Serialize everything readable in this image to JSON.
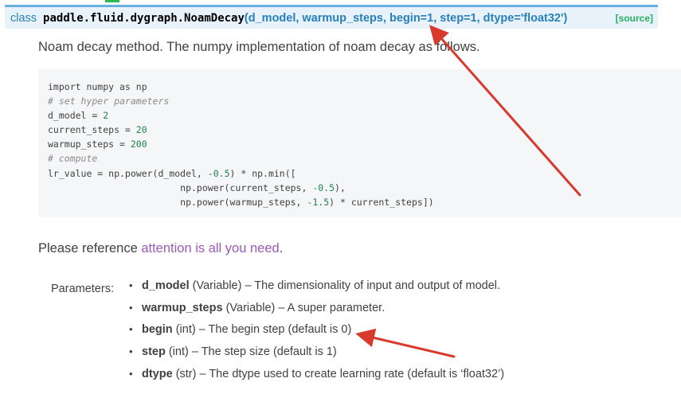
{
  "signature": {
    "keyword": "class",
    "name": "paddle.fluid.dygraph.NoamDecay",
    "params": "(d_model, warmup_steps, begin=1, step=1, dtype='float32')",
    "source_link": "[source]"
  },
  "description": "Noam decay method. The numpy implementation of noam decay as follows.",
  "code": {
    "lines": [
      "import numpy as np",
      "# set hyper parameters",
      "d_model = 2",
      "current_steps = 20",
      "warmup_steps = 200",
      "# compute",
      "lr_value = np.power(d_model, -0.5) * np.min([",
      "                        np.power(current_steps, -0.5),",
      "                        np.power(warmup_steps, -1.5) * current_steps])"
    ]
  },
  "reference": {
    "prefix": "Please reference ",
    "link": "attention is all you need",
    "suffix": "."
  },
  "parameters": {
    "label": "Parameters:",
    "items": [
      {
        "name": "d_model",
        "desc": " (Variable) – The dimensionality of input and output of model."
      },
      {
        "name": "warmup_steps",
        "desc": " (Variable) – A super parameter."
      },
      {
        "name": "begin",
        "desc": " (int) – The begin step (default is 0)"
      },
      {
        "name": "step",
        "desc": " (int) – The step size (default is 1)"
      },
      {
        "name": "dtype",
        "desc": " (str) – The dtype used to create learning rate (default is ‘float32’)"
      }
    ]
  },
  "colors": {
    "link": "#2980b9",
    "visited_link": "#9b59b6",
    "signature_bg": "#e7f2fa",
    "source": "#27ae60",
    "annotation_arrow": "#d83a2e"
  },
  "icons": {
    "bullet": "•"
  }
}
